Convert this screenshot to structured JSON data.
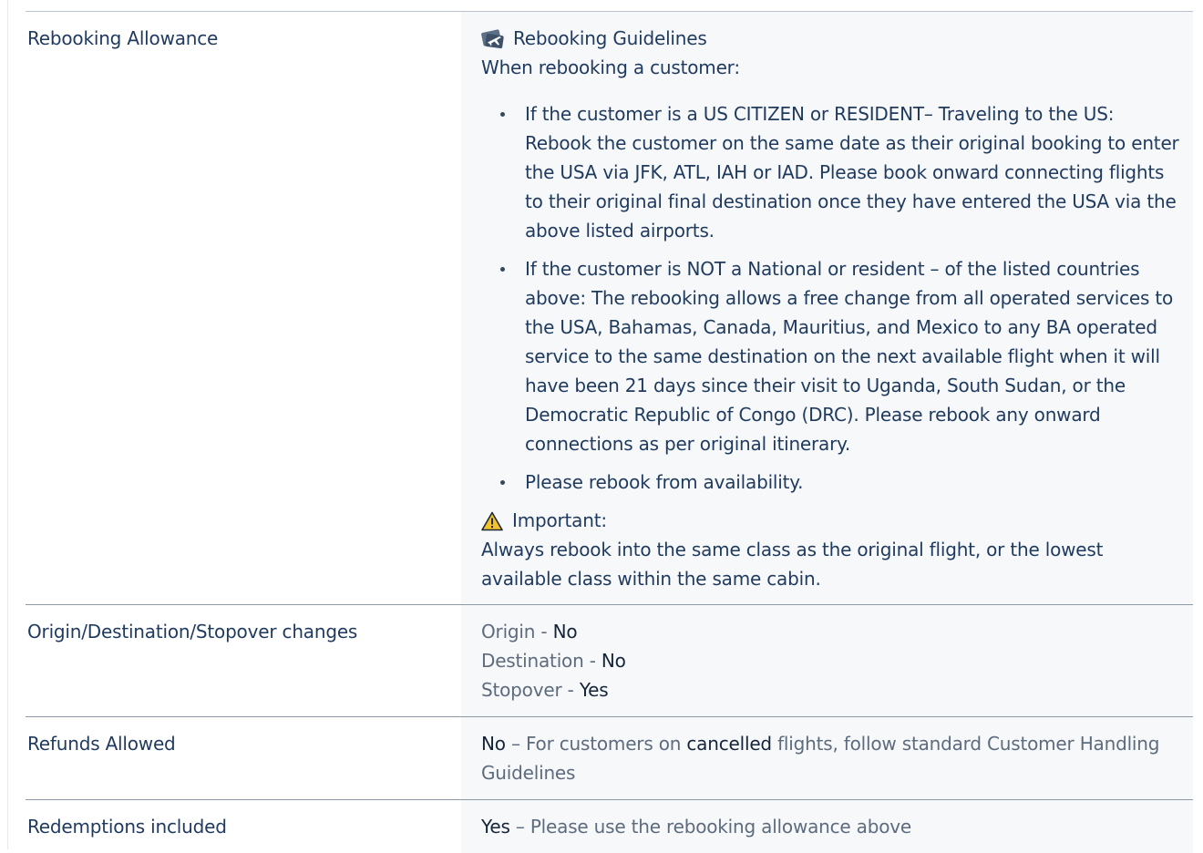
{
  "rows": [
    {
      "label": "Rebooking Allowance",
      "heading": "Rebooking Guidelines",
      "intro": "When rebooking a customer:",
      "bullets": [
        "If the customer is a US CITIZEN or RESIDENT– Traveling to the US: Rebook the customer on the same date as their original booking to enter the USA via JFK, ATL, IAH or IAD. Please book onward connecting flights to their original final destination once they have entered the USA via the above listed airports.",
        "If the customer is NOT a National or resident – of the listed countries above: The rebooking allows a free change from all operated services to the USA, Bahamas, Canada, Mauritius, and Mexico to any BA operated service to the same destination on the next available flight when it will have been 21 days since their visit to Uganda, South Sudan, or the Democratic Republic of Congo (DRC). Please rebook any onward connections as per original itinerary.",
        "Please rebook from availability."
      ],
      "important_title": "Important:",
      "important_text": "Always rebook into the same class as the original flight, or the lowest available class within the same cabin."
    },
    {
      "label": "Origin/Destination/Stopover changes",
      "items": [
        {
          "key": "Origin",
          "sep": " - ",
          "value": "No"
        },
        {
          "key": "Destination",
          "sep": " - ",
          "value": "No"
        },
        {
          "key": "Stopover",
          "sep": " - ",
          "value": "Yes"
        }
      ]
    },
    {
      "label": "Refunds Allowed",
      "value_strong": "No",
      "sep": " – ",
      "text_before": "For customers on ",
      "text_emph": "cancelled",
      "text_after": " flights, follow standard Customer Handling Guidelines"
    },
    {
      "label": "Redemptions included",
      "value_strong": "Yes",
      "sep": " – ",
      "text": "Please use the rebooking allowance above"
    }
  ],
  "icons": {
    "guidelines": "airplane-ticket-icon",
    "important": "warning-triangle-icon"
  },
  "colors": {
    "text": "#1f3a5f",
    "muted": "#5d6b7e",
    "value_bg": "#f7f8f9",
    "rule": "#8e99a6",
    "warning": "#f2c12e"
  }
}
